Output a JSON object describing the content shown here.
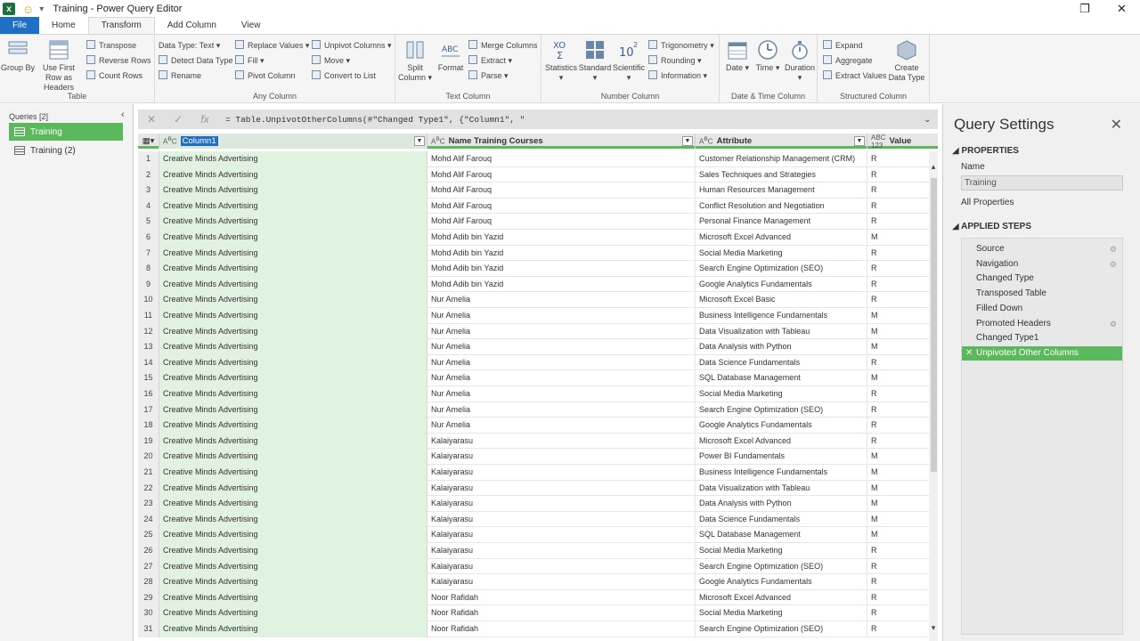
{
  "window": {
    "title": "Training - Power Query Editor",
    "restore_glyph": "❐",
    "close_glyph": "✕"
  },
  "tabs": [
    {
      "label": "File"
    },
    {
      "label": "Home"
    },
    {
      "label": "Transform"
    },
    {
      "label": "Add Column"
    },
    {
      "label": "View"
    }
  ],
  "ribbon": {
    "table": {
      "label": "Table",
      "group_by": "Group By",
      "first_row": "Use First Row as Headers",
      "transpose": "Transpose",
      "reverse_rows": "Reverse Rows",
      "count_rows": "Count Rows"
    },
    "any_column": {
      "label": "Any Column",
      "data_type": "Data Type: Text",
      "detect_type": "Detect Data Type",
      "rename": "Rename",
      "replace_values": "Replace Values",
      "fill": "Fill",
      "pivot": "Pivot Column",
      "unpivot": "Unpivot Columns",
      "move": "Move",
      "convert_list": "Convert to List"
    },
    "text_column": {
      "label": "Text Column",
      "split": "Split Column",
      "format": "Format",
      "merge": "Merge Columns",
      "extract": "Extract",
      "parse": "Parse"
    },
    "number_column": {
      "label": "Number Column",
      "statistics": "Statistics",
      "standard": "Standard",
      "scientific": "Scientific",
      "trig": "Trigonometry",
      "rounding": "Rounding",
      "information": "Information"
    },
    "datetime_column": {
      "label": "Date & Time Column",
      "date": "Date",
      "time": "Time",
      "duration": "Duration"
    },
    "structured_column": {
      "label": "Structured Column",
      "expand": "Expand",
      "aggregate": "Aggregate",
      "extract_values": "Extract Values",
      "create_type": "Create Data Type"
    }
  },
  "queries": {
    "header": "Queries [2]",
    "items": [
      "Training",
      "Training (2)"
    ]
  },
  "formula": {
    "text": "= Table.UnpivotOtherColumns(#\"Changed Type1\", {\"Column1\", \""
  },
  "grid": {
    "headers": {
      "col1": "Column1",
      "name": "Name Training Courses",
      "attr": "Attribute",
      "val": "Value"
    },
    "rows": [
      {
        "n": "1",
        "c1": "Creative Minds Advertising",
        "name": "Mohd Alif Farouq",
        "attr": "Customer Relationship Management (CRM)",
        "val": "R"
      },
      {
        "n": "2",
        "c1": "Creative Minds Advertising",
        "name": "Mohd Alif Farouq",
        "attr": "Sales Techniques and Strategies",
        "val": "R"
      },
      {
        "n": "3",
        "c1": "Creative Minds Advertising",
        "name": "Mohd Alif Farouq",
        "attr": "Human Resources Management",
        "val": "R"
      },
      {
        "n": "4",
        "c1": "Creative Minds Advertising",
        "name": "Mohd Alif Farouq",
        "attr": "Conflict Resolution and Negotiation",
        "val": "R"
      },
      {
        "n": "5",
        "c1": "Creative Minds Advertising",
        "name": "Mohd Alif Farouq",
        "attr": "Personal Finance Management",
        "val": "R"
      },
      {
        "n": "6",
        "c1": "Creative Minds Advertising",
        "name": "Mohd Adib bin Yazid",
        "attr": "Microsoft Excel Advanced",
        "val": "M"
      },
      {
        "n": "7",
        "c1": "Creative Minds Advertising",
        "name": "Mohd Adib bin Yazid",
        "attr": "Social Media Marketing",
        "val": "R"
      },
      {
        "n": "8",
        "c1": "Creative Minds Advertising",
        "name": "Mohd Adib bin Yazid",
        "attr": "Search Engine Optimization (SEO)",
        "val": "R"
      },
      {
        "n": "9",
        "c1": "Creative Minds Advertising",
        "name": "Mohd Adib bin Yazid",
        "attr": "Google Analytics Fundamentals",
        "val": "R"
      },
      {
        "n": "10",
        "c1": "Creative Minds Advertising",
        "name": "Nur Amelia",
        "attr": "Microsoft Excel Basic",
        "val": "R"
      },
      {
        "n": "11",
        "c1": "Creative Minds Advertising",
        "name": "Nur Amelia",
        "attr": "Business Intelligence Fundamentals",
        "val": "M"
      },
      {
        "n": "12",
        "c1": "Creative Minds Advertising",
        "name": "Nur Amelia",
        "attr": "Data Visualization with Tableau",
        "val": "M"
      },
      {
        "n": "13",
        "c1": "Creative Minds Advertising",
        "name": "Nur Amelia",
        "attr": "Data Analysis with Python",
        "val": "M"
      },
      {
        "n": "14",
        "c1": "Creative Minds Advertising",
        "name": "Nur Amelia",
        "attr": "Data Science Fundamentals",
        "val": "R"
      },
      {
        "n": "15",
        "c1": "Creative Minds Advertising",
        "name": "Nur Amelia",
        "attr": "SQL Database Management",
        "val": "M"
      },
      {
        "n": "16",
        "c1": "Creative Minds Advertising",
        "name": "Nur Amelia",
        "attr": "Social Media Marketing",
        "val": "R"
      },
      {
        "n": "17",
        "c1": "Creative Minds Advertising",
        "name": "Nur Amelia",
        "attr": "Search Engine Optimization (SEO)",
        "val": "R"
      },
      {
        "n": "18",
        "c1": "Creative Minds Advertising",
        "name": "Nur Amelia",
        "attr": "Google Analytics Fundamentals",
        "val": "R"
      },
      {
        "n": "19",
        "c1": "Creative Minds Advertising",
        "name": "Kalaiyarasu",
        "attr": "Microsoft Excel Advanced",
        "val": "R"
      },
      {
        "n": "20",
        "c1": "Creative Minds Advertising",
        "name": "Kalaiyarasu",
        "attr": "Power BI Fundamentals",
        "val": "M"
      },
      {
        "n": "21",
        "c1": "Creative Minds Advertising",
        "name": "Kalaiyarasu",
        "attr": "Business Intelligence Fundamentals",
        "val": "M"
      },
      {
        "n": "22",
        "c1": "Creative Minds Advertising",
        "name": "Kalaiyarasu",
        "attr": "Data Visualization with Tableau",
        "val": "M"
      },
      {
        "n": "23",
        "c1": "Creative Minds Advertising",
        "name": "Kalaiyarasu",
        "attr": "Data Analysis with Python",
        "val": "M"
      },
      {
        "n": "24",
        "c1": "Creative Minds Advertising",
        "name": "Kalaiyarasu",
        "attr": "Data Science Fundamentals",
        "val": "M"
      },
      {
        "n": "25",
        "c1": "Creative Minds Advertising",
        "name": "Kalaiyarasu",
        "attr": "SQL Database Management",
        "val": "M"
      },
      {
        "n": "26",
        "c1": "Creative Minds Advertising",
        "name": "Kalaiyarasu",
        "attr": "Social Media Marketing",
        "val": "R"
      },
      {
        "n": "27",
        "c1": "Creative Minds Advertising",
        "name": "Kalaiyarasu",
        "attr": "Search Engine Optimization (SEO)",
        "val": "R"
      },
      {
        "n": "28",
        "c1": "Creative Minds Advertising",
        "name": "Kalaiyarasu",
        "attr": "Google Analytics Fundamentals",
        "val": "R"
      },
      {
        "n": "29",
        "c1": "Creative Minds Advertising",
        "name": "Noor Rafidah",
        "attr": "Microsoft Excel Advanced",
        "val": "R"
      },
      {
        "n": "30",
        "c1": "Creative Minds Advertising",
        "name": "Noor Rafidah",
        "attr": "Social Media Marketing",
        "val": "R"
      },
      {
        "n": "31",
        "c1": "Creative Minds Advertising",
        "name": "Noor Rafidah",
        "attr": "Search Engine Optimization (SEO)",
        "val": "R"
      }
    ]
  },
  "settings": {
    "title": "Query Settings",
    "properties": "PROPERTIES",
    "name_label": "Name",
    "name_value": "Training",
    "all_properties": "All Properties",
    "applied_steps": "APPLIED STEPS",
    "steps": [
      {
        "label": "Source",
        "gear": true
      },
      {
        "label": "Navigation",
        "gear": true
      },
      {
        "label": "Changed Type",
        "gear": false
      },
      {
        "label": "Transposed Table",
        "gear": false
      },
      {
        "label": "Filled Down",
        "gear": false
      },
      {
        "label": "Promoted Headers",
        "gear": true
      },
      {
        "label": "Changed Type1",
        "gear": false
      },
      {
        "label": "Unpivoted Other Columns",
        "gear": false,
        "active": true
      }
    ]
  },
  "colors": {
    "accent_green": "#5cb85c",
    "file_blue": "#1f6fc4",
    "selected_col_bg": "#e0f2e0"
  }
}
